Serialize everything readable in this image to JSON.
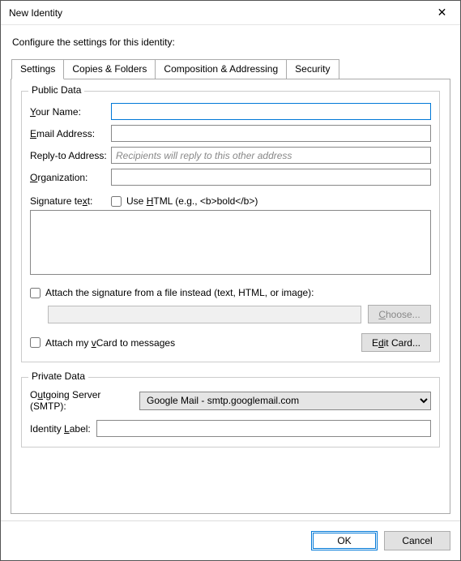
{
  "window": {
    "title": "New Identity",
    "close_icon": "✕"
  },
  "intro": "Configure the settings for this identity:",
  "tabs": {
    "settings": "Settings",
    "copies": "Copies & Folders",
    "composition": "Composition & Addressing",
    "security": "Security"
  },
  "public": {
    "legend": "Public Data",
    "your_name_pre": "Y",
    "your_name_rest": "our Name:",
    "your_name_value": "",
    "email_pre": "E",
    "email_rest": "mail Address:",
    "email_value": "",
    "reply_label": "Reply-to Address:",
    "reply_placeholder": "Recipients will reply to this other address",
    "reply_value": "",
    "org_pre": "O",
    "org_rest": "rganization:",
    "org_value": "",
    "sig_pre": "Signature te",
    "sig_u": "x",
    "sig_post": "t:",
    "use_html_pre": "Use ",
    "use_html_u": "H",
    "use_html_post": "TML (e.g., <b>bold</b>)",
    "use_html_checked": false,
    "sig_value": "",
    "attach_file_pre": "Attach the si",
    "attach_file_u": "g",
    "attach_file_post": "nature from a file instead (text, HTML, or image):",
    "attach_file_checked": false,
    "choose_pre": "",
    "choose_u": "C",
    "choose_post": "hoose...",
    "attach_vcard_pre": "Attach my ",
    "attach_vcard_u": "v",
    "attach_vcard_post": "Card to messages",
    "attach_vcard_checked": false,
    "edit_card_pre": "E",
    "edit_card_u": "d",
    "edit_card_post": "it Card..."
  },
  "private": {
    "legend": "Private Data",
    "smtp_pre": "O",
    "smtp_u": "u",
    "smtp_post": "tgoing Server (SMTP):",
    "smtp_value": "Google Mail - smtp.googlemail.com",
    "id_label_pre": "Identity ",
    "id_label_u": "L",
    "id_label_post": "abel:",
    "id_value": ""
  },
  "footer": {
    "ok": "OK",
    "cancel": "Cancel"
  }
}
